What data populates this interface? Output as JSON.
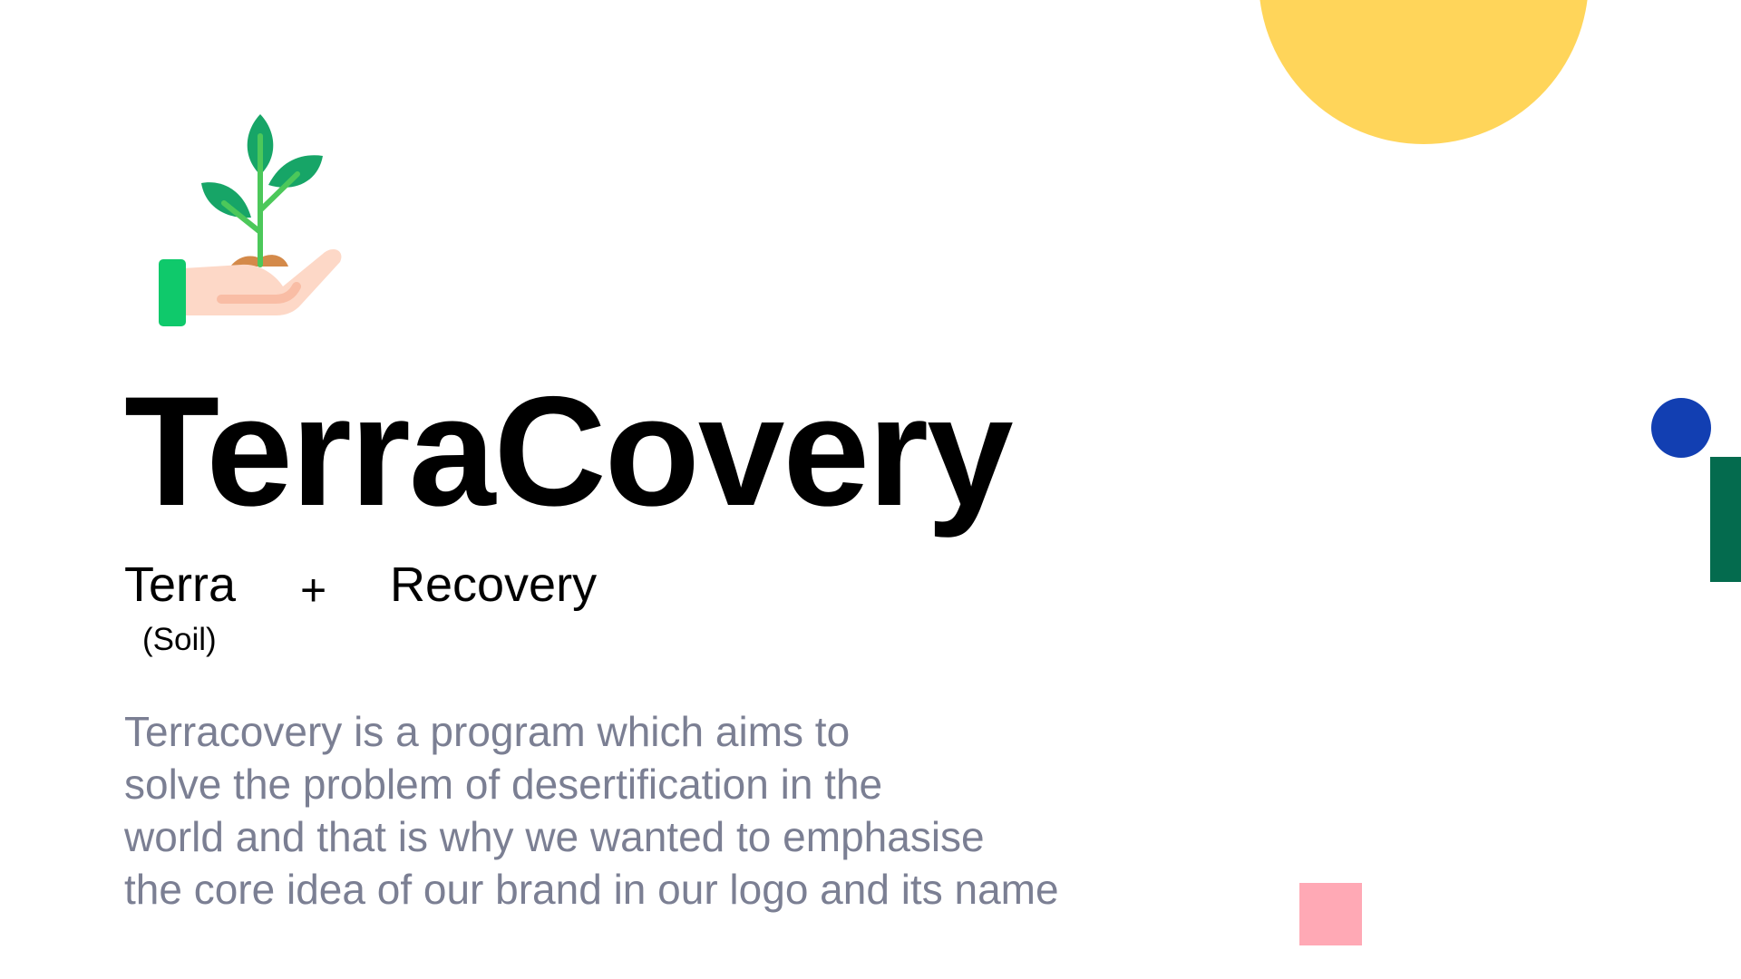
{
  "brand": {
    "name": "TerraCovery"
  },
  "etymology": {
    "part1": "Terra",
    "part1_meaning": "(Soil)",
    "operator": "+",
    "part2": "Recovery"
  },
  "description": {
    "lines": [
      "Terracovery is a program which aims to",
      "solve the problem of desertification in the",
      "world and that is why we wanted to emphasise",
      "the core idea of our brand in our logo and its name"
    ],
    "color": "#7b7f93"
  },
  "logo": {
    "icon": "hand-holding-sprout-icon",
    "colors": {
      "leaf": "#17a567",
      "stem": "#4cc85a",
      "hand": "#fdd8c7",
      "hand_shadow": "#f9bda5",
      "soil": "#d48a4a",
      "cuff": "#0fc96b"
    }
  },
  "decorations": {
    "sun_color": "#ffd55a",
    "dot_color": "#123fb2",
    "bar_color": "#046b4e",
    "square_color": "#ffa9b5"
  }
}
